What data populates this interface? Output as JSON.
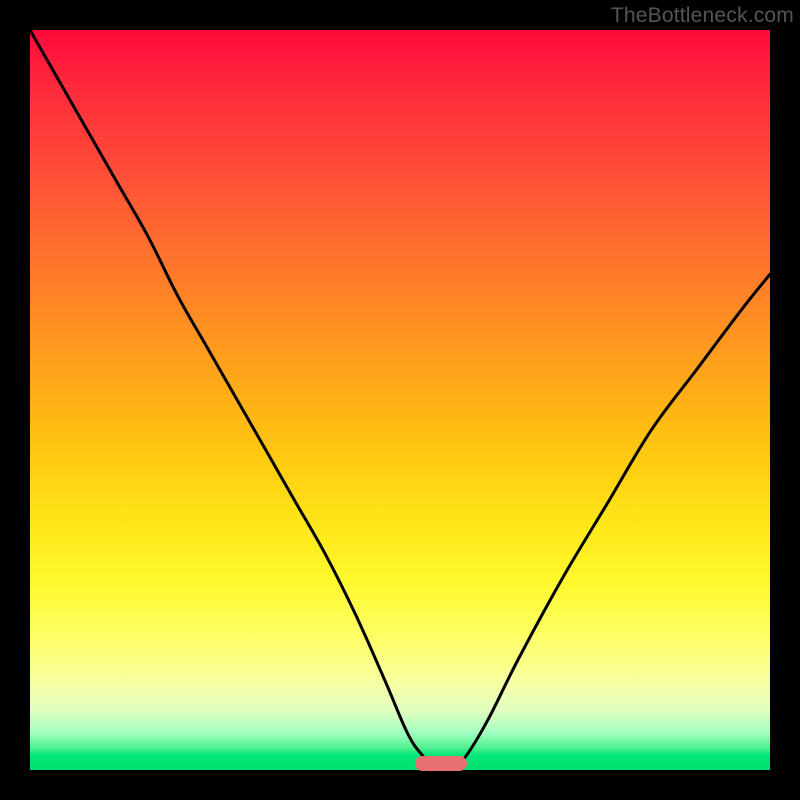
{
  "watermark": "TheBottleneck.com",
  "chart_data": {
    "type": "line",
    "title": "",
    "xlabel": "",
    "ylabel": "",
    "xlim": [
      0,
      100
    ],
    "ylim": [
      0,
      100
    ],
    "grid": false,
    "legend": false,
    "background": "vertical-gradient-red-to-green",
    "series": [
      {
        "name": "bottleneck-curve",
        "x": [
          0,
          4,
          8,
          12,
          16,
          20,
          24,
          28,
          32,
          36,
          40,
          44,
          48,
          51,
          53,
          55,
          57,
          59,
          62,
          66,
          72,
          78,
          84,
          90,
          96,
          100
        ],
        "y": [
          100,
          93,
          86,
          79,
          72,
          64,
          57,
          50,
          43,
          36,
          29,
          21,
          12,
          5,
          2,
          0,
          0,
          2,
          7,
          15,
          26,
          36,
          46,
          54,
          62,
          67
        ]
      }
    ],
    "marker": {
      "x": 55.5,
      "y": 0,
      "width_pct": 7,
      "color": "#e87070"
    },
    "annotations": []
  },
  "colors": {
    "page_bg": "#000000",
    "watermark": "#555555",
    "curve": "#000000",
    "marker": "#e87070"
  }
}
